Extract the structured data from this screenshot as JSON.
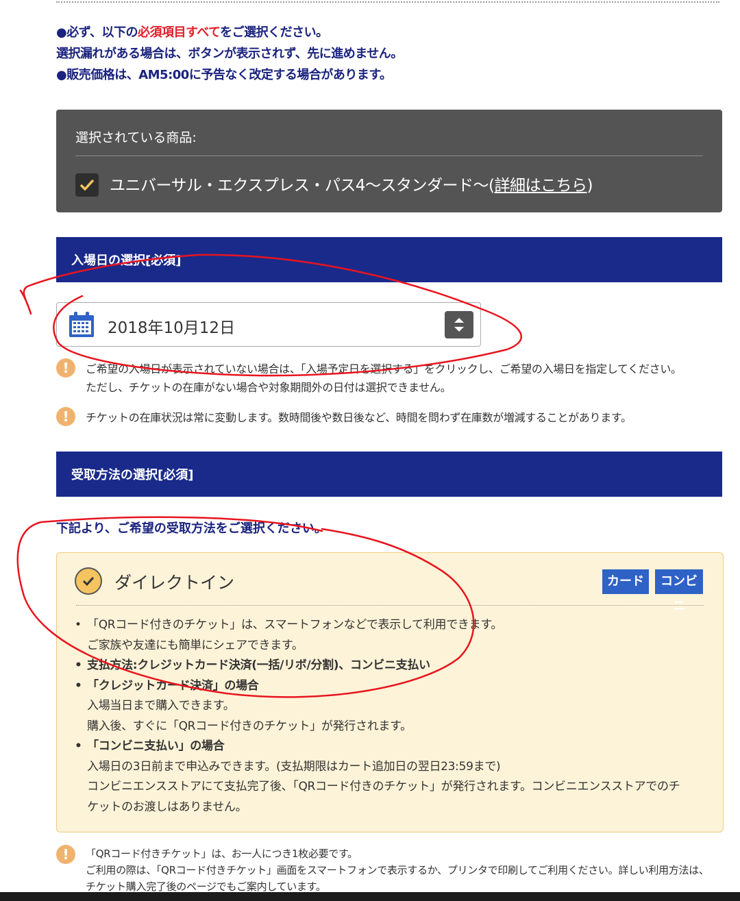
{
  "notice": {
    "line1_prefix": "●必ず、以下の",
    "line1_red": "必須項目すべて",
    "line1_suffix": "をご選択ください。",
    "line2": "選択漏れがある場合は、ボタンが表示されず、先に進めません。",
    "line3": "●販売価格は、AM5:00に予告なく改定する場合があります。"
  },
  "selected": {
    "title": "選択されている商品:",
    "product": "ユニバーサル・エクスプレス・パス4〜スタンダード〜",
    "detail_open": "(",
    "detail_link": "詳細はこちら",
    "detail_close": ")"
  },
  "section_date": {
    "title": "入場日の選択[必須]"
  },
  "date_field": {
    "value": "2018年10月12日"
  },
  "warnings_date": [
    {
      "line1": "ご希望の入場日が表示されていない場合は、「入場予定日を選択する」をクリックし、ご希望の入場日を指定してください。",
      "line2": "ただし、チケットの在庫がない場合や対象期間外の日付は選択できません。"
    },
    {
      "line1": "チケットの在庫状況は常に変動します。数時間後や数日後など、時間を問わず在庫数が増減することがあります。"
    }
  ],
  "section_receive": {
    "title": "受取方法の選択[必須]"
  },
  "receive_intro": "下記より、ご希望の受取方法をご選択ください。",
  "option": {
    "title": "ダイレクトイン",
    "badges": [
      "カード",
      "コンビニ"
    ],
    "lines": [
      "「QRコード付きのチケット」は、スマートフォンなどで表示して利用できます。",
      "ご家族や友達にも簡単にシェアできます。",
      "支払方法:クレジットカード決済(一括/リボ/分割)、コンビニ支払い",
      "「クレジットカード決済」の場合",
      "入場当日まで購入できます。",
      "購入後、すぐに「QRコード付きのチケット」が発行されます。",
      "「コンビニ支払い」の場合",
      "入場日の3日前まで申込みできます。(支払期限はカート追加日の翌日23:59まで)",
      "コンビニエンスストアにて支払完了後、「QRコード付きのチケット」が発行されます。コンビニエンスストアでのチ",
      "ケットのお渡しはありません。"
    ]
  },
  "warning_bottom": {
    "line1": "「QRコード付きチケット」は、お一人につき1枚必要です。",
    "line2": "ご利用の際は、「QRコード付きチケット」画面をスマートフォンで表示するか、プリンタで印刷してご利用ください。詳しい利用方法は、",
    "line3": "チケット購入完了後のページでもご案内しています。"
  },
  "colors": {
    "navy_bar": "#1a2a8a",
    "notice_text": "#1a237e",
    "required_red": "#e0202a",
    "option_bg": "#fdf3d8",
    "badge_blue": "#2f62c7",
    "annotation_red": "#e8141e"
  },
  "icons": [
    "check-icon",
    "calendar-icon",
    "sort-arrows-icon",
    "warning-icon",
    "check-circle-icon"
  ]
}
